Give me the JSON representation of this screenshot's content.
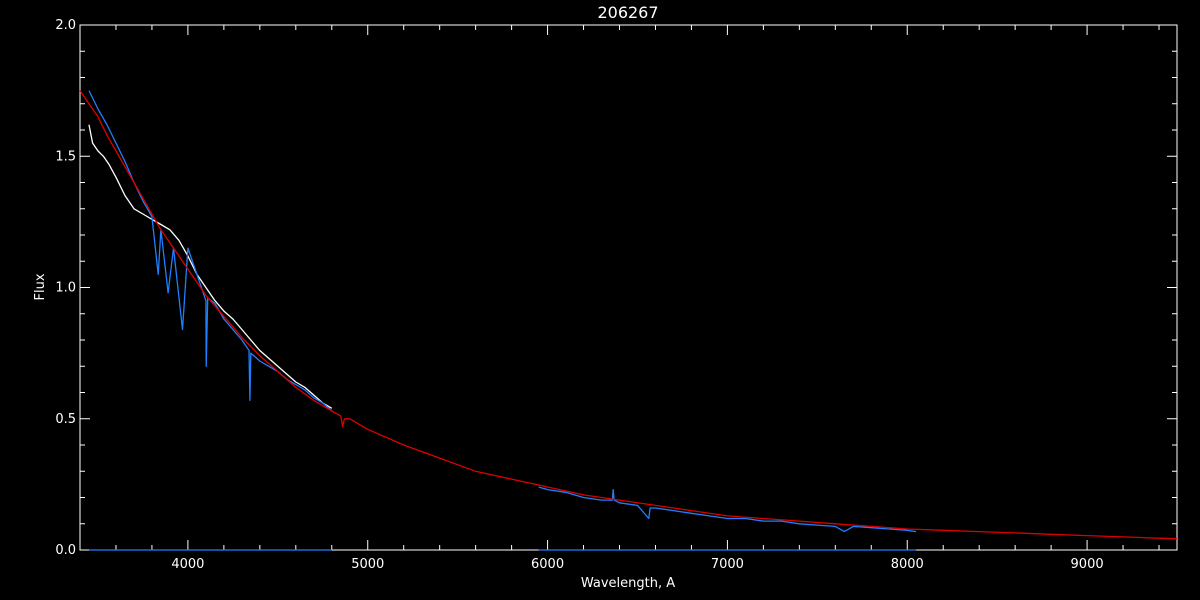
{
  "chart_data": {
    "type": "line",
    "title": "206267",
    "xlabel": "Wavelength, A",
    "ylabel": "Flux",
    "xlim": [
      3400,
      9500
    ],
    "ylim": [
      0.0,
      2.0
    ],
    "xticks": [
      4000,
      5000,
      6000,
      7000,
      8000,
      9000
    ],
    "xtick_labels": [
      "4000",
      "5000",
      "6000",
      "7000",
      "8000",
      "9000"
    ],
    "yticks": [
      0.0,
      0.5,
      1.0,
      1.5,
      2.0
    ],
    "ytick_labels": [
      "0.0",
      "0.5",
      "1.0",
      "1.5",
      "2.0"
    ],
    "grid": false,
    "series": [
      {
        "color": "#ffffff",
        "x": [
          3450,
          3470,
          3500,
          3530,
          3560,
          3600,
          3650,
          3700,
          3750,
          3800,
          3850,
          3900,
          3950,
          4000,
          4050,
          4100,
          4150,
          4200,
          4250,
          4300,
          4350,
          4400,
          4450,
          4500,
          4550,
          4600,
          4650,
          4700,
          4750,
          4800
        ],
        "y": [
          1.62,
          1.55,
          1.52,
          1.5,
          1.47,
          1.42,
          1.35,
          1.3,
          1.28,
          1.26,
          1.24,
          1.22,
          1.18,
          1.12,
          1.05,
          1.0,
          0.95,
          0.91,
          0.88,
          0.84,
          0.8,
          0.76,
          0.73,
          0.7,
          0.67,
          0.64,
          0.62,
          0.59,
          0.56,
          0.54
        ]
      },
      {
        "color": "#1e7fff",
        "x": [
          3450,
          3500,
          3550,
          3600,
          3650,
          3700,
          3750,
          3800,
          3835,
          3850,
          3870,
          3890,
          3920,
          3970,
          4000,
          4050,
          4100,
          4102,
          4110,
          4150,
          4200,
          4250,
          4300,
          4340,
          4345,
          4350,
          4400,
          4450,
          4500,
          4550,
          4600,
          4650,
          4700,
          4750,
          4800
        ],
        "y": [
          1.75,
          1.68,
          1.62,
          1.55,
          1.48,
          1.4,
          1.33,
          1.27,
          1.05,
          1.22,
          1.1,
          0.98,
          1.15,
          0.84,
          1.15,
          1.05,
          0.95,
          0.7,
          0.96,
          0.94,
          0.88,
          0.84,
          0.8,
          0.76,
          0.57,
          0.75,
          0.72,
          0.7,
          0.68,
          0.65,
          0.63,
          0.61,
          0.58,
          0.56,
          0.53
        ]
      },
      {
        "color": "#1e7fff",
        "x": [
          5950,
          6000,
          6100,
          6200,
          6300,
          6360,
          6365,
          6370,
          6400,
          6500,
          6563,
          6570,
          6600,
          6700,
          6800,
          6900,
          7000,
          7100,
          7200,
          7300,
          7400,
          7500,
          7600,
          7650,
          7700,
          7800,
          7900,
          8000,
          8050
        ],
        "y": [
          0.24,
          0.23,
          0.22,
          0.2,
          0.19,
          0.19,
          0.23,
          0.19,
          0.18,
          0.17,
          0.12,
          0.16,
          0.16,
          0.15,
          0.14,
          0.13,
          0.12,
          0.12,
          0.11,
          0.11,
          0.1,
          0.095,
          0.09,
          0.07,
          0.09,
          0.085,
          0.08,
          0.075,
          0.07
        ]
      },
      {
        "color": "#dd0000",
        "x": [
          3400,
          3450,
          3500,
          3550,
          3600,
          3650,
          3700,
          3750,
          3800,
          3850,
          3900,
          3950,
          4000,
          4050,
          4100,
          4150,
          4200,
          4300,
          4400,
          4500,
          4600,
          4700,
          4800,
          4850,
          4860,
          4870,
          4900,
          5000,
          5200,
          5400,
          5600,
          5800,
          6000,
          6200,
          6400,
          6600,
          6800,
          7000,
          7200,
          7400,
          7600,
          7800,
          8000,
          8200,
          8400,
          8600,
          8800,
          9000,
          9200,
          9400,
          9500
        ],
        "y": [
          1.75,
          1.7,
          1.65,
          1.58,
          1.52,
          1.46,
          1.4,
          1.34,
          1.28,
          1.22,
          1.17,
          1.12,
          1.07,
          1.02,
          0.97,
          0.93,
          0.89,
          0.81,
          0.74,
          0.68,
          0.62,
          0.57,
          0.53,
          0.51,
          0.47,
          0.5,
          0.5,
          0.46,
          0.4,
          0.35,
          0.3,
          0.27,
          0.24,
          0.21,
          0.19,
          0.17,
          0.15,
          0.13,
          0.12,
          0.11,
          0.1,
          0.09,
          0.08,
          0.075,
          0.07,
          0.065,
          0.06,
          0.055,
          0.05,
          0.045,
          0.043
        ]
      },
      {
        "color": "#1e7fff",
        "x": [
          3450,
          3600,
          3800,
          4000,
          4200,
          4400,
          4600,
          4800
        ],
        "y": [
          0.0,
          0.0,
          0.0,
          0.0,
          0.0,
          0.0,
          0.0,
          0.0
        ]
      },
      {
        "color": "#1e7fff",
        "x": [
          5950,
          6200,
          6500,
          7000,
          7500,
          8000,
          8050
        ],
        "y": [
          0.0,
          0.0,
          0.0,
          0.0,
          0.0,
          0.0,
          0.0
        ]
      }
    ]
  }
}
